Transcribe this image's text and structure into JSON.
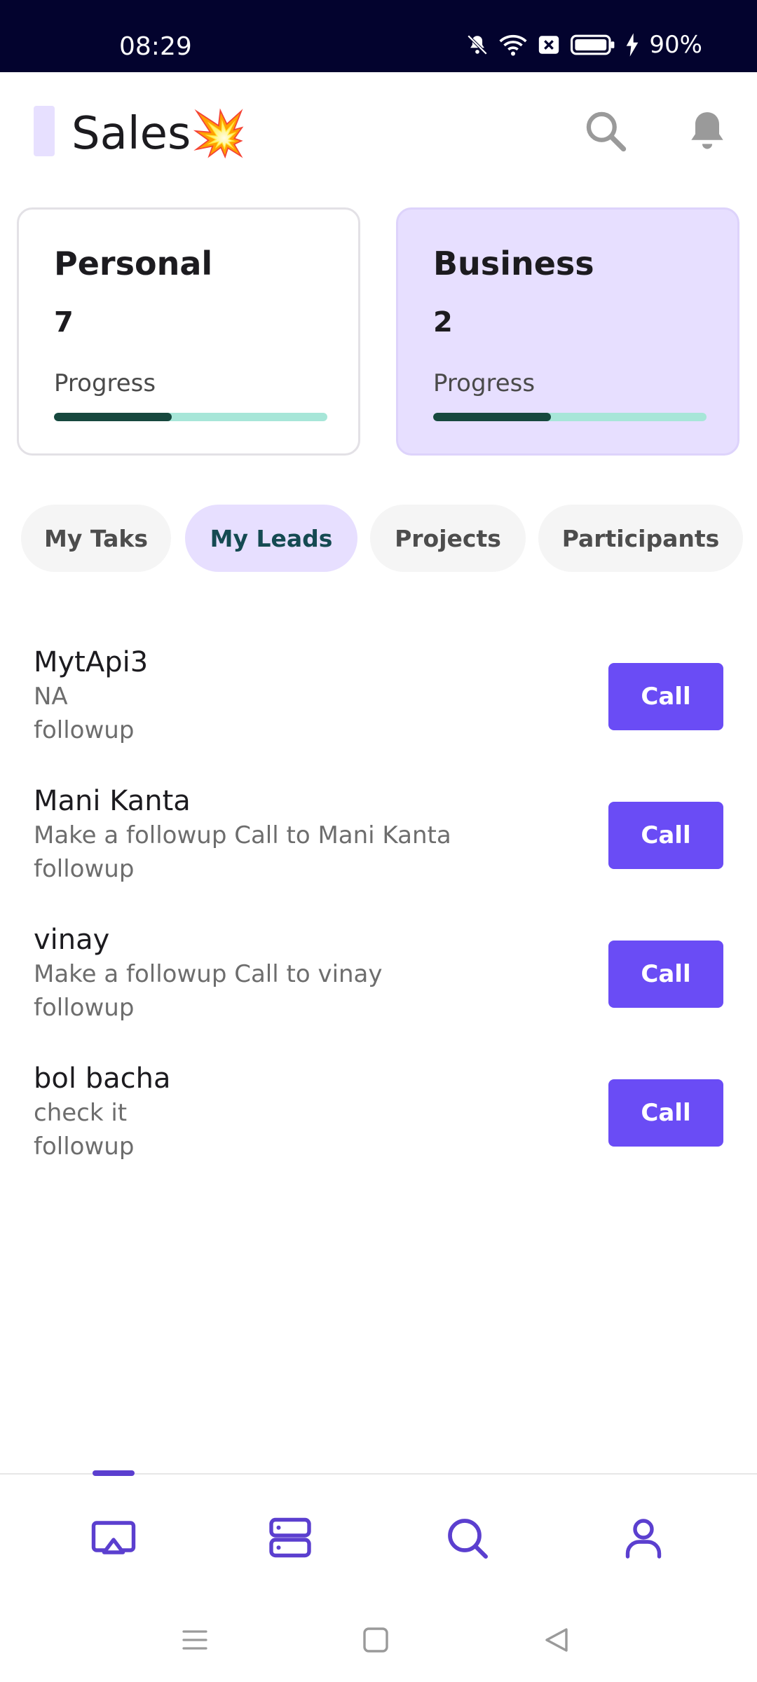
{
  "status_bar": {
    "time": "08:29",
    "battery": "90%",
    "icons": [
      "bell-muted-icon",
      "wifi-icon",
      "close-box-icon",
      "battery-icon",
      "charging-bolt-icon"
    ]
  },
  "header": {
    "title": "Sales💥",
    "icons": [
      "search-icon",
      "bell-icon"
    ]
  },
  "cards": [
    {
      "title": "Personal",
      "count": "7",
      "progress_label": "Progress",
      "progress": 0.43
    },
    {
      "title": "Business",
      "count": "2",
      "progress_label": "Progress",
      "progress": 0.43
    }
  ],
  "tabs": [
    {
      "label": "My Taks",
      "active": false
    },
    {
      "label": "My Leads",
      "active": true
    },
    {
      "label": "Projects",
      "active": false
    },
    {
      "label": "Participants",
      "active": false
    }
  ],
  "leads": [
    {
      "name": "MytApi3",
      "description": "NA",
      "status": "followup",
      "action": "Call"
    },
    {
      "name": "Mani Kanta",
      "description": "Make a followup Call to Mani Kanta",
      "status": "followup",
      "action": "Call"
    },
    {
      "name": "vinay",
      "description": "Make a followup Call to vinay",
      "status": "followup",
      "action": "Call"
    },
    {
      "name": "bol bacha",
      "description": "check it",
      "status": "followup",
      "action": "Call"
    }
  ],
  "bottom_nav": {
    "items": [
      "cast-icon",
      "server-icon",
      "search-icon",
      "profile-icon"
    ],
    "active_index": 0
  },
  "system_nav": [
    "menu-icon",
    "home-square-icon",
    "back-triangle-icon"
  ],
  "colors": {
    "accent": "#6a4cf5",
    "card_business_bg": "#e7dfff",
    "progress_fill": "#17483e",
    "progress_track": "#a7e6d8",
    "status_bar_bg": "#03032e"
  }
}
